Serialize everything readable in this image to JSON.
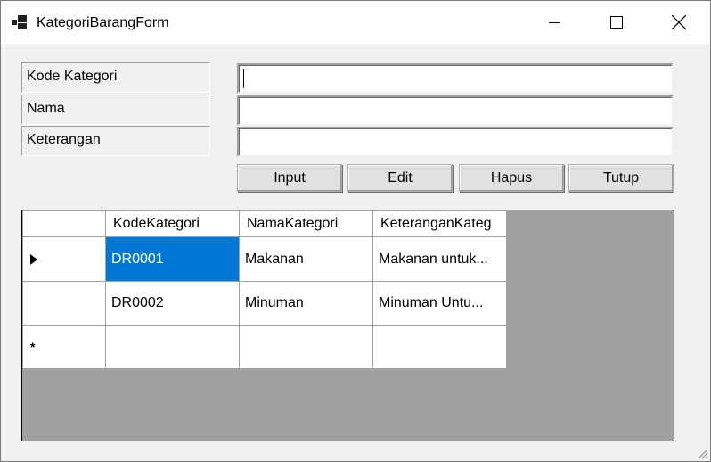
{
  "window": {
    "title": "KategoriBarangForm"
  },
  "form": {
    "kode_label": "Kode Kategori",
    "nama_label": "Nama",
    "keterangan_label": "Keterangan",
    "kode_value": "",
    "nama_value": "",
    "keterangan_value": ""
  },
  "buttons": {
    "input": "Input",
    "edit": "Edit",
    "hapus": "Hapus",
    "tutup": "Tutup"
  },
  "grid": {
    "columns": [
      "KodeKategori",
      "NamaKategori",
      "KeteranganKateg"
    ],
    "rows": [
      {
        "kode": "DR0001",
        "nama": "Makanan",
        "keterangan": "Makanan untuk..."
      },
      {
        "kode": "DR0002",
        "nama": "Minuman",
        "keterangan": "Minuman Untu..."
      }
    ],
    "new_row_marker": "*",
    "current_row_indicator": "triangle-right-icon"
  },
  "colors": {
    "selection": "#0078d7",
    "grid_background": "#a0a0a0",
    "form_background": "#f0f0f0"
  }
}
